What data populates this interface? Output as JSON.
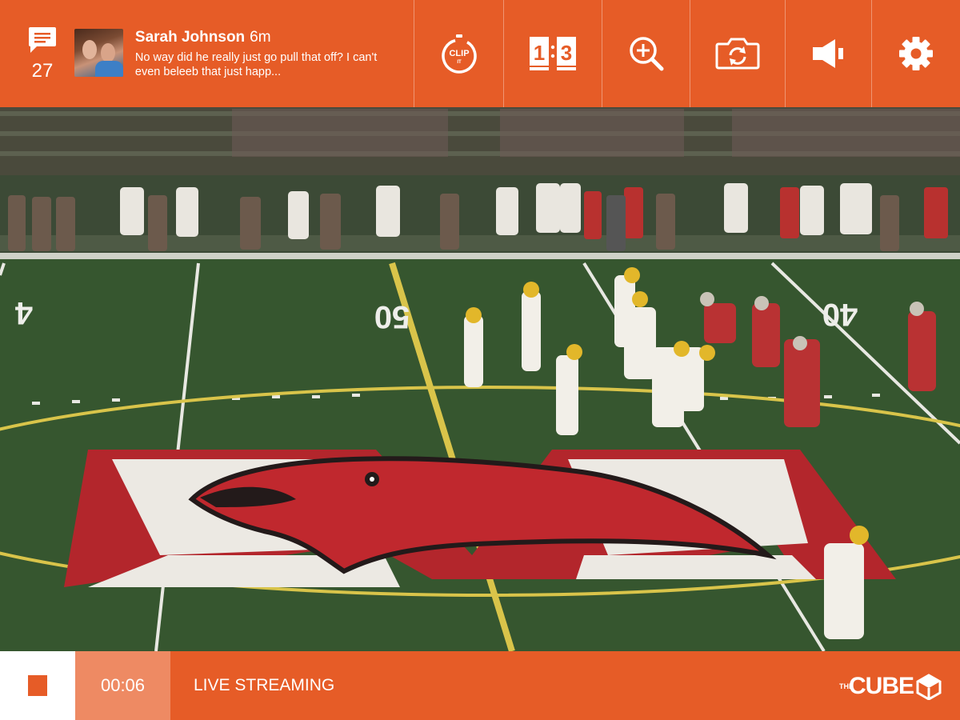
{
  "colors": {
    "accent": "#e65c27",
    "accent_light": "#ee8a63",
    "white": "#ffffff"
  },
  "chat": {
    "icon": "chat-bubble-icon",
    "count": "27"
  },
  "message": {
    "author": "Sarah Johnson",
    "time": "6m",
    "text": "No way did he really just go pull that off? I can't even beleeb that just happ..."
  },
  "toolbar": [
    {
      "name": "clip-it",
      "icon": "clip-it-icon",
      "label": "CLIP IT"
    },
    {
      "name": "score",
      "icon": "scoreboard-icon",
      "home": "1",
      "away": "3"
    },
    {
      "name": "zoom",
      "icon": "zoom-in-icon"
    },
    {
      "name": "switch-camera",
      "icon": "camera-switch-icon"
    },
    {
      "name": "volume",
      "icon": "speaker-icon"
    },
    {
      "name": "settings",
      "icon": "gear-icon"
    }
  ],
  "video": {
    "yard_numbers": [
      "4",
      "50",
      "40"
    ]
  },
  "bottom": {
    "stop_icon": "stop-icon",
    "timer": "00:06",
    "status": "LIVE STREAMING",
    "brand_small": "THE",
    "brand_large": "CUBE"
  }
}
